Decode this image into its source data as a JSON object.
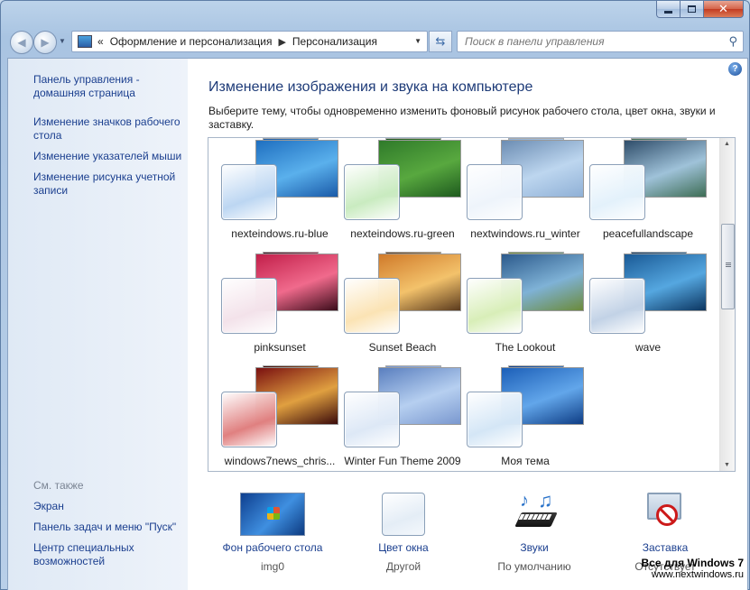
{
  "window": {
    "minimize_icon": "minimize-icon",
    "maximize_icon": "maximize-icon",
    "close_label": "✕"
  },
  "address_bar": {
    "overflow": "«",
    "crumbs": [
      "Оформление и персонализация",
      "Персонализация"
    ]
  },
  "search": {
    "placeholder": "Поиск в панели управления"
  },
  "sidebar": {
    "links": [
      "Панель управления - домашняя страница",
      "Изменение значков рабочего стола",
      "Изменение указателей мыши",
      "Изменение рисунка учетной записи"
    ],
    "see_also_title": "См. также",
    "see_also": [
      "Экран",
      "Панель задач и меню \"Пуск\"",
      "Центр специальных возможностей"
    ]
  },
  "main": {
    "help": "?",
    "title": "Изменение изображения и звука на компьютере",
    "description": "Выберите тему, чтобы одновременно изменить фоновый рисунок рабочего стола, цвет окна, звуки и заставку."
  },
  "themes": [
    {
      "name": "nexteindows.ru-blue",
      "colors": [
        "#1f6fc0",
        "#5ab0ec",
        "#1a5aa8"
      ],
      "glass": "#bcd6f2"
    },
    {
      "name": "nexteindows.ru-green",
      "colors": [
        "#2f7a2a",
        "#58a83f",
        "#1e5a1e"
      ],
      "glass": "#c9ebc0"
    },
    {
      "name": "nextwindows.ru_winter",
      "colors": [
        "#6c8db3",
        "#bdd6ef",
        "#8fb0d6"
      ],
      "glass": "#eef4fb"
    },
    {
      "name": "peacefullandscape",
      "colors": [
        "#2f4d6a",
        "#9fc2d9",
        "#3e6d55"
      ],
      "glass": "#e3f1fb"
    },
    {
      "name": "pinksunset",
      "colors": [
        "#c21f4a",
        "#f06a8c",
        "#3a0c1a"
      ],
      "glass": "#f3e2ea"
    },
    {
      "name": "Sunset Beach",
      "colors": [
        "#d07a2a",
        "#f3c26b",
        "#5a3a1d"
      ],
      "glass": "#fbe3b4"
    },
    {
      "name": "The Lookout",
      "colors": [
        "#2c5a8c",
        "#7fb2d6",
        "#6b8a3a"
      ],
      "glass": "#d8eeb8"
    },
    {
      "name": "wave",
      "colors": [
        "#1a5a96",
        "#55a7e0",
        "#0b3560"
      ],
      "glass": "#c2d2e6"
    },
    {
      "name": "windows7news_chris...",
      "colors": [
        "#7a1010",
        "#e0a040",
        "#3a0a0a"
      ],
      "glass": "#e08080"
    },
    {
      "name": "Winter Fun Theme 2009",
      "colors": [
        "#5a7fbf",
        "#b6cff0",
        "#7a98cf"
      ],
      "glass": "#dde8f6"
    },
    {
      "name": "Моя тема",
      "colors": [
        "#1c5fb8",
        "#62a6ea",
        "#0e3d85"
      ],
      "glass": "#d4e6f6"
    }
  ],
  "actions": [
    {
      "label": "Фон рабочего стола",
      "value": "img0",
      "icon": "desktop-background-icon"
    },
    {
      "label": "Цвет окна",
      "value": "Другой",
      "icon": "window-color-icon"
    },
    {
      "label": "Звуки",
      "value": "По умолчанию",
      "icon": "sounds-icon"
    },
    {
      "label": "Заставка",
      "value": "Отсутствует",
      "icon": "screensaver-icon"
    }
  ],
  "watermark": {
    "line1": "Все для Windows 7",
    "line2": "www.nextwindows.ru"
  }
}
